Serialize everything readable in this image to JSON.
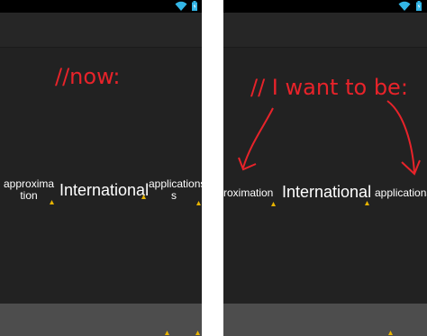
{
  "left_panel": {
    "annotation": "//now:",
    "pages": {
      "previous": "approxima\ntion",
      "current": "International",
      "next": "applications\ns"
    }
  },
  "right_panel": {
    "annotation": "// I want to be:",
    "pages": {
      "previous": "roximation",
      "current": "International",
      "next": "applications"
    }
  },
  "colors": {
    "annotation": "#e8232a",
    "background": "#222222",
    "status_bar": "#000000",
    "bottom_bar": "#4d4d4d",
    "accent": "#33b5e5",
    "warning": "#e8b400"
  },
  "icons": {
    "wifi": "wifi-icon",
    "battery": "battery-icon",
    "warning": "warning-icon"
  }
}
